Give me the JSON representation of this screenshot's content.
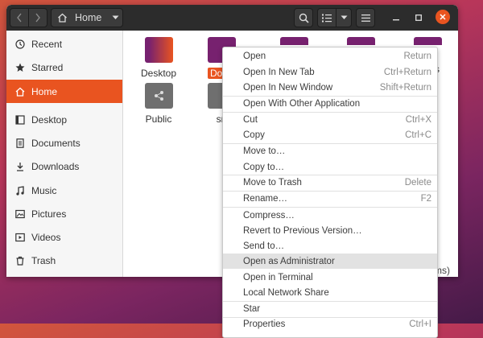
{
  "window": {
    "location_label": "Home",
    "status_text": "ms)"
  },
  "sidebar": {
    "items": [
      {
        "label": "Recent",
        "icon": "clock-icon"
      },
      {
        "label": "Starred",
        "icon": "star-icon"
      },
      {
        "label": "Home",
        "icon": "home-icon",
        "active": true
      },
      {
        "label": "Desktop",
        "icon": "desktop-icon"
      },
      {
        "label": "Documents",
        "icon": "document-icon"
      },
      {
        "label": "Downloads",
        "icon": "download-icon"
      },
      {
        "label": "Music",
        "icon": "music-icon"
      },
      {
        "label": "Pictures",
        "icon": "picture-icon"
      },
      {
        "label": "Videos",
        "icon": "video-icon"
      },
      {
        "label": "Trash",
        "icon": "trash-icon"
      }
    ]
  },
  "files": [
    {
      "label": "Desktop"
    },
    {
      "label": "Docu"
    },
    {
      "label": "Public"
    },
    {
      "label": "sn"
    },
    {
      "label": "s"
    }
  ],
  "context_menu": {
    "items": [
      {
        "label": "Open",
        "shortcut": "Return"
      },
      {
        "label": "Open In New Tab",
        "shortcut": "Ctrl+Return"
      },
      {
        "label": "Open In New Window",
        "shortcut": "Shift+Return"
      },
      {
        "label": "Open With Other Application",
        "shortcut": ""
      },
      {
        "label": "Cut",
        "shortcut": "Ctrl+X"
      },
      {
        "label": "Copy",
        "shortcut": "Ctrl+C"
      },
      {
        "label": "Move to…",
        "shortcut": ""
      },
      {
        "label": "Copy to…",
        "shortcut": ""
      },
      {
        "label": "Move to Trash",
        "shortcut": "Delete"
      },
      {
        "label": "Rename…",
        "shortcut": "F2"
      },
      {
        "label": "Compress…",
        "shortcut": ""
      },
      {
        "label": "Revert to Previous Version…",
        "shortcut": ""
      },
      {
        "label": "Send to…",
        "shortcut": ""
      },
      {
        "label": "Open as Administrator",
        "shortcut": ""
      },
      {
        "label": "Open in Terminal",
        "shortcut": ""
      },
      {
        "label": "Local Network Share",
        "shortcut": ""
      },
      {
        "label": "Star",
        "shortcut": ""
      },
      {
        "label": "Properties",
        "shortcut": "Ctrl+I"
      }
    ]
  },
  "colors": {
    "accent": "#e95420",
    "headerbar": "#2c2c2c",
    "close_button": "#e95420"
  }
}
